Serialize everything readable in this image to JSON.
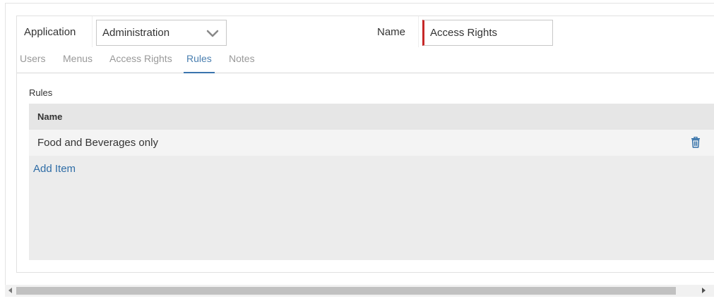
{
  "form": {
    "application_label": "Application",
    "application_value": "Administration",
    "name_label": "Name",
    "name_value": "Access Rights"
  },
  "tabs": [
    {
      "label": "Users",
      "active": false
    },
    {
      "label": "Menus",
      "active": false
    },
    {
      "label": "Access Rights",
      "active": false
    },
    {
      "label": "Rules",
      "active": true
    },
    {
      "label": "Notes",
      "active": false
    }
  ],
  "rules": {
    "section_title": "Rules",
    "column_header": "Name",
    "rows": [
      {
        "name": "Food and Beverages only"
      }
    ],
    "add_item_label": "Add Item"
  },
  "icons": {
    "dropdown": "chevron-down-icon",
    "delete": "trash-icon"
  },
  "colors": {
    "accent": "#3a74ad",
    "link": "#2f6da6",
    "required_marker": "#c62828"
  }
}
